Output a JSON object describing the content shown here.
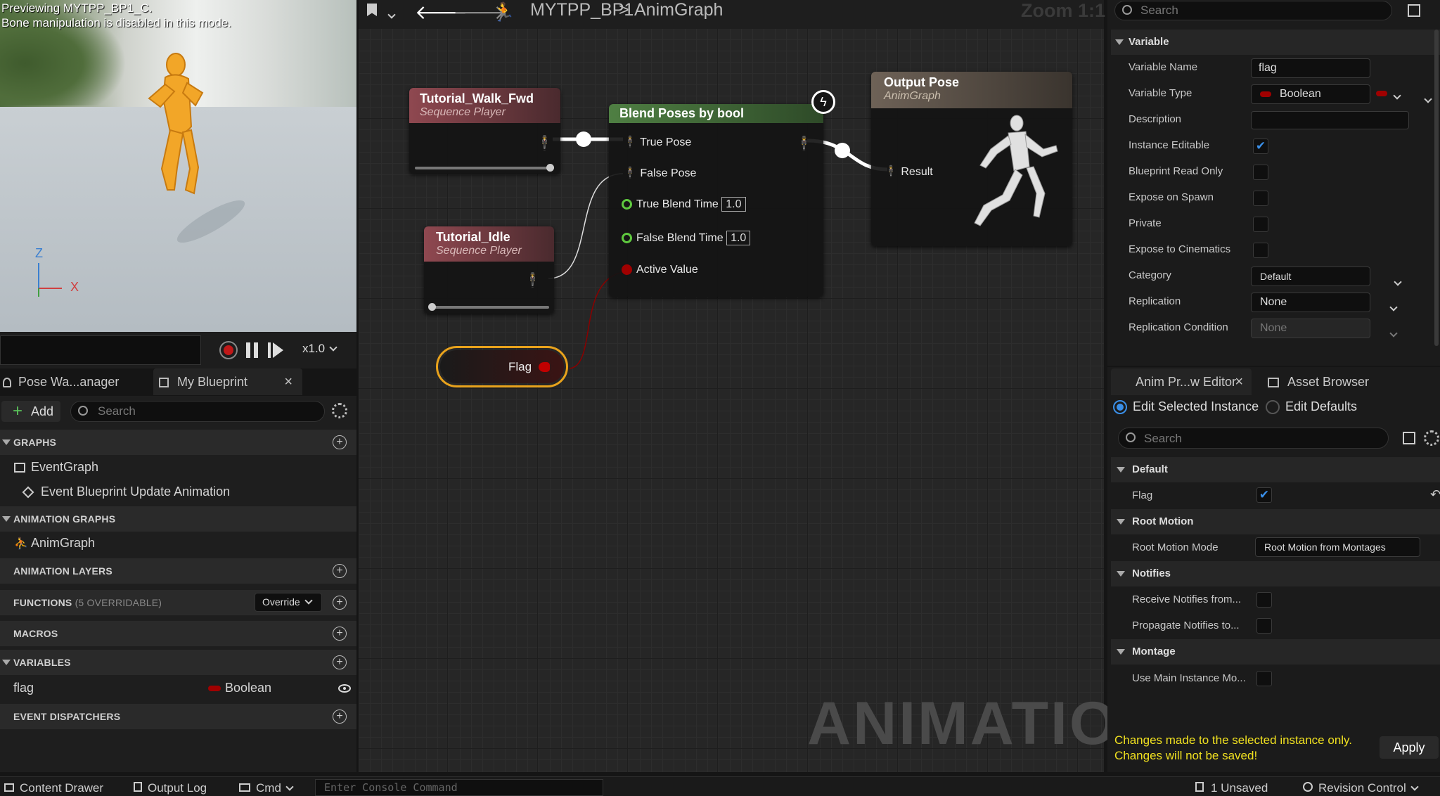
{
  "viewport": {
    "line1": "Previewing MYTPP_BP1_C.",
    "line2": "Bone manipulation is disabled in this mode.",
    "axis_z": "Z",
    "axis_x": "X",
    "speed": "x1.0"
  },
  "left_tabs": {
    "tab1": "Pose Wa...anager",
    "tab2": "My Blueprint",
    "close": "×"
  },
  "myblueprint": {
    "add_label": "Add",
    "search_placeholder": "Search",
    "graphs_header": "GRAPHS",
    "event_graph": "EventGraph",
    "event_update": "Event Blueprint Update Animation",
    "anim_graphs_header": "ANIMATION GRAPHS",
    "anim_graph": "AnimGraph",
    "anim_layers_header": "ANIMATION LAYERS",
    "functions_header": "FUNCTIONS",
    "functions_count": "(5 OVERRIDABLE)",
    "override_label": "Override",
    "macros_header": "MACROS",
    "variables_header": "VARIABLES",
    "var_name": "flag",
    "var_type": "Boolean",
    "dispatchers_header": "EVENT DISPATCHERS"
  },
  "graph": {
    "breadcrumb_blueprint": "MYTPP_BP1",
    "breadcrumb_sep": ">",
    "breadcrumb_graph": "AnimGraph",
    "zoom": "Zoom 1:1",
    "watermark": "ANIMATION",
    "nodes": {
      "walk_title": "Tutorial_Walk_Fwd",
      "walk_sub": "Sequence Player",
      "idle_title": "Tutorial_Idle",
      "idle_sub": "Sequence Player",
      "blend_title": "Blend Poses by bool",
      "true_pose": "True Pose",
      "false_pose": "False Pose",
      "true_blend": "True Blend Time",
      "true_blend_val": "1.0",
      "false_blend": "False Blend Time",
      "false_blend_val": "1.0",
      "active_value": "Active Value",
      "output_title": "Output Pose",
      "output_sub": "AnimGraph",
      "result": "Result",
      "flag": "Flag"
    }
  },
  "details": {
    "search_placeholder": "Search",
    "section": "Variable",
    "rows": {
      "name_label": "Variable Name",
      "name_val": "flag",
      "type_label": "Variable Type",
      "type_val": "Boolean",
      "desc_label": "Description",
      "inst_label": "Instance Editable",
      "bro_label": "Blueprint Read Only",
      "spawn_label": "Expose on Spawn",
      "private_label": "Private",
      "cine_label": "Expose to Cinematics",
      "cat_label": "Category",
      "cat_val": "Default",
      "rep_label": "Replication",
      "rep_val": "None",
      "repcond_label": "Replication Condition",
      "repcond_val": "None"
    }
  },
  "anim_preview": {
    "tab1": "Anim Pr...w Editor",
    "close": "×",
    "tab2": "Asset Browser",
    "radio1": "Edit Selected Instance",
    "radio2": "Edit Defaults",
    "search_placeholder": "Search",
    "sec_default": "Default",
    "flag_label": "Flag",
    "sec_root": "Root Motion",
    "root_mode_label": "Root Motion Mode",
    "root_mode_val": "Root Motion from Montages",
    "sec_notifies": "Notifies",
    "notify1": "Receive Notifies from...",
    "notify2": "Propagate Notifies to...",
    "sec_montage": "Montage",
    "montage1": "Use Main Instance Mo...",
    "warn1": "Changes made to the selected instance only.",
    "warn2": "Changes will not be saved!",
    "apply": "Apply"
  },
  "bottombar": {
    "content_drawer": "Content Drawer",
    "output_log": "Output Log",
    "cmd": "Cmd",
    "console_placeholder": "Enter Console Command",
    "unsaved": "1 Unsaved",
    "revision": "Revision Control"
  },
  "colors": {
    "accent": "#2a7fd8",
    "bool": "#a00000",
    "flag_outline": "#e8a21c",
    "warn": "#f0e020",
    "blend_head": "#4f7f43",
    "seq_head": "#8f4850",
    "out_head": "#6e6257"
  }
}
